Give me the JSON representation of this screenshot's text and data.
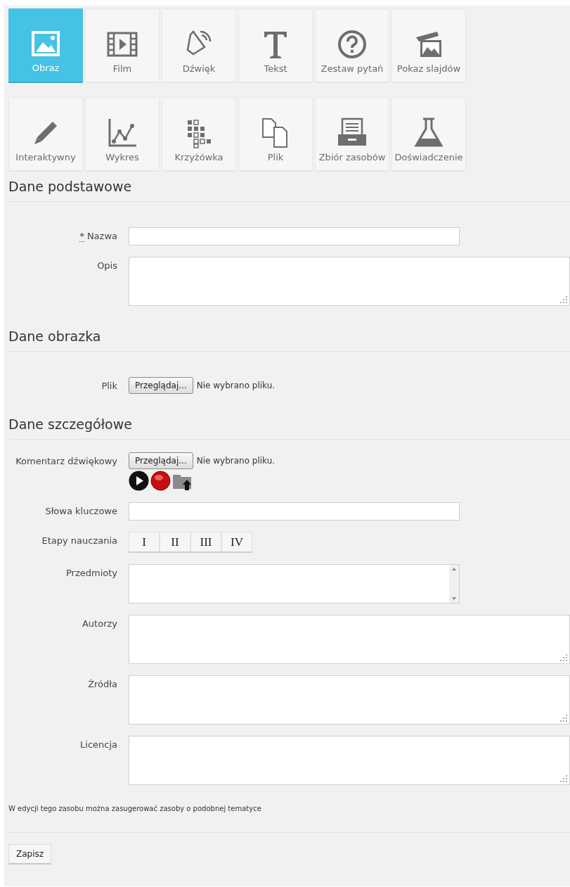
{
  "resource_types": [
    {
      "kind": "image",
      "label": "Obraz",
      "selected": true
    },
    {
      "kind": "film",
      "label": "Film",
      "selected": false
    },
    {
      "kind": "sound",
      "label": "Dźwięk",
      "selected": false
    },
    {
      "kind": "text",
      "label": "Tekst",
      "selected": false
    },
    {
      "kind": "quiz",
      "label": "Zestaw pytań",
      "selected": false
    },
    {
      "kind": "slides",
      "label": "Pokaz slajdów",
      "selected": false
    },
    {
      "kind": "interactive",
      "label": "Interaktywny",
      "selected": false
    },
    {
      "kind": "chart",
      "label": "Wykres",
      "selected": false
    },
    {
      "kind": "crossword",
      "label": "Krzyżówka",
      "selected": false
    },
    {
      "kind": "file",
      "label": "Plik",
      "selected": false
    },
    {
      "kind": "collection",
      "label": "Zbiór zasobów",
      "selected": false
    },
    {
      "kind": "experiment",
      "label": "Doświadczenie",
      "selected": false
    }
  ],
  "sections": [
    {
      "title": "Dane podstawowe",
      "fields": [
        {
          "kind": "text",
          "label": "Nazwa",
          "required_mark": "*"
        },
        {
          "kind": "textarea",
          "label": "Opis"
        }
      ]
    },
    {
      "title": "Dane obrazka",
      "fields": [
        {
          "kind": "file",
          "label": "Plik",
          "button": "Przeglądaj...",
          "status": "Nie wybrano pliku."
        }
      ]
    },
    {
      "title": "Dane szczegółowe",
      "fields": [
        {
          "kind": "audio",
          "label": "Komentarz dźwiękowy",
          "button": "Przeglądaj...",
          "status": "Nie wybrano pliku."
        },
        {
          "kind": "text",
          "label": "Słowa kluczowe"
        },
        {
          "kind": "stages",
          "label": "Etapy nauczania",
          "options": [
            {
              "label": "I",
              "selected": false
            },
            {
              "label": "II",
              "selected": false
            },
            {
              "label": "III",
              "selected": false
            },
            {
              "label": "IV",
              "selected": false
            }
          ]
        },
        {
          "kind": "listbox",
          "label": "Przedmioty"
        },
        {
          "kind": "textarea",
          "label": "Autorzy"
        },
        {
          "kind": "textarea",
          "label": "Źródła"
        },
        {
          "kind": "textarea",
          "label": "Licencja"
        }
      ]
    }
  ],
  "note": "W edycji tego zasobu można zasugerować zasoby o podobnej tematyce",
  "save_button": "Zapisz"
}
